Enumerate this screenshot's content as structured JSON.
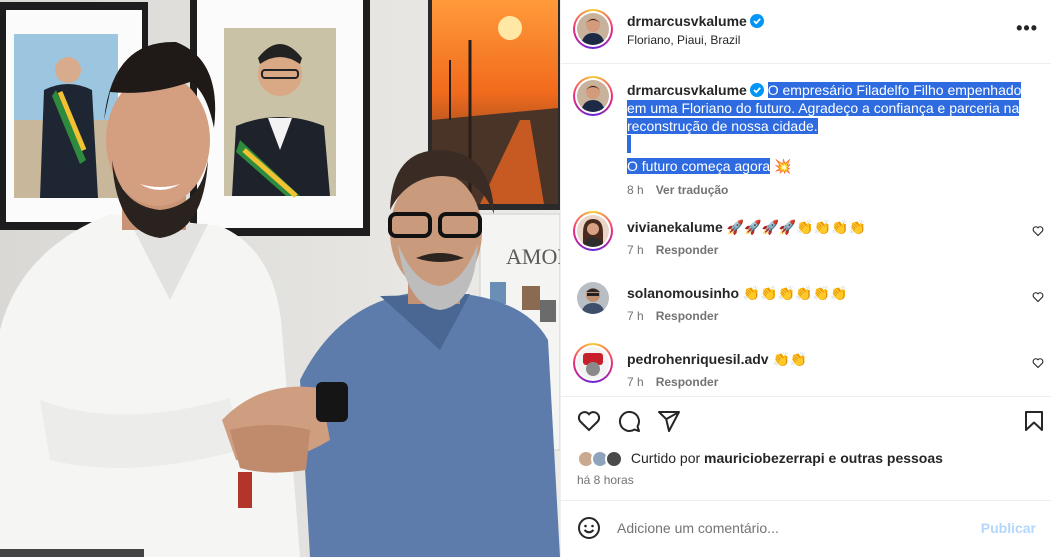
{
  "post": {
    "author": "drmarcusvkalume",
    "location": "Floriano, Piaui, Brazil",
    "caption_lines": [
      "O empresário Filadelfo Filho empenhado",
      "em uma Floriano do futuro. Agradeço a confiança e parceria na",
      "reconstrução de nossa cidade.",
      "O futuro começa agora"
    ],
    "caption_emoji": "💥",
    "time": "8 h",
    "translate": "Ver tradução"
  },
  "comments": [
    {
      "user": "vivianekalume",
      "text": "🚀🚀🚀🚀👏👏👏👏",
      "time": "7 h",
      "reply": "Responder"
    },
    {
      "user": "solanomousinho",
      "text": "👏👏👏👏👏👏",
      "time": "7 h",
      "reply": "Responder"
    },
    {
      "user": "pedrohenriquesil.adv",
      "text": "👏👏",
      "time": "7 h",
      "reply": "Responder"
    }
  ],
  "likes": {
    "prefix": "Curtido por",
    "user": "mauriciobezerrapi",
    "suffix": "e outras pessoas",
    "ago": "há 8 horas"
  },
  "add_comment": {
    "placeholder": "Adicione um comentário...",
    "post_label": "Publicar"
  },
  "photo": {
    "wall_sign": "AMOR"
  },
  "icons": {
    "more": "more-options-icon",
    "like": "heart-icon",
    "comment": "comment-icon",
    "share": "share-icon",
    "save": "bookmark-icon",
    "emoji": "emoji-icon",
    "verified": "verified-badge-icon"
  },
  "colors": {
    "selection": "#2e6be0",
    "verified": "#0095f6",
    "muted": "#737373",
    "publish_disabled": "#b3d7fb"
  }
}
